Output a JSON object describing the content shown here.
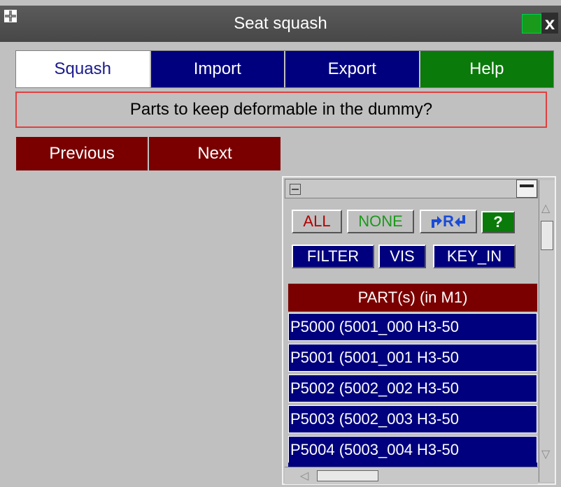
{
  "window": {
    "title": "Seat squash",
    "close_label": "x"
  },
  "tabs": [
    {
      "label": "Squash"
    },
    {
      "label": "Import"
    },
    {
      "label": "Export"
    },
    {
      "label": "Help"
    }
  ],
  "prompt": "Parts to keep deformable in the dummy?",
  "nav": {
    "previous_label": "Previous",
    "next_label": "Next"
  },
  "selector": {
    "all_label": "ALL",
    "none_label": "NONE",
    "reverse_label": "R",
    "help_label": "?",
    "filter_label": "FILTER",
    "vis_label": "VIS",
    "keyin_label": "KEY_IN",
    "list_header": "PART(s) (in M1)",
    "items": [
      "P5000 (5001_000 H3-50",
      "P5001 (5001_001 H3-50",
      "P5002 (5002_002 H3-50",
      "P5003 (5002_003 H3-50",
      "P5004 (5003_004 H3-50"
    ]
  },
  "colors": {
    "title_bar": "#474747",
    "tab_active_bg": "#ffffff",
    "tab_blue": "#00007e",
    "help_green": "#0a7a0a",
    "nav_red": "#7a0000",
    "prompt_border": "#e04040"
  }
}
